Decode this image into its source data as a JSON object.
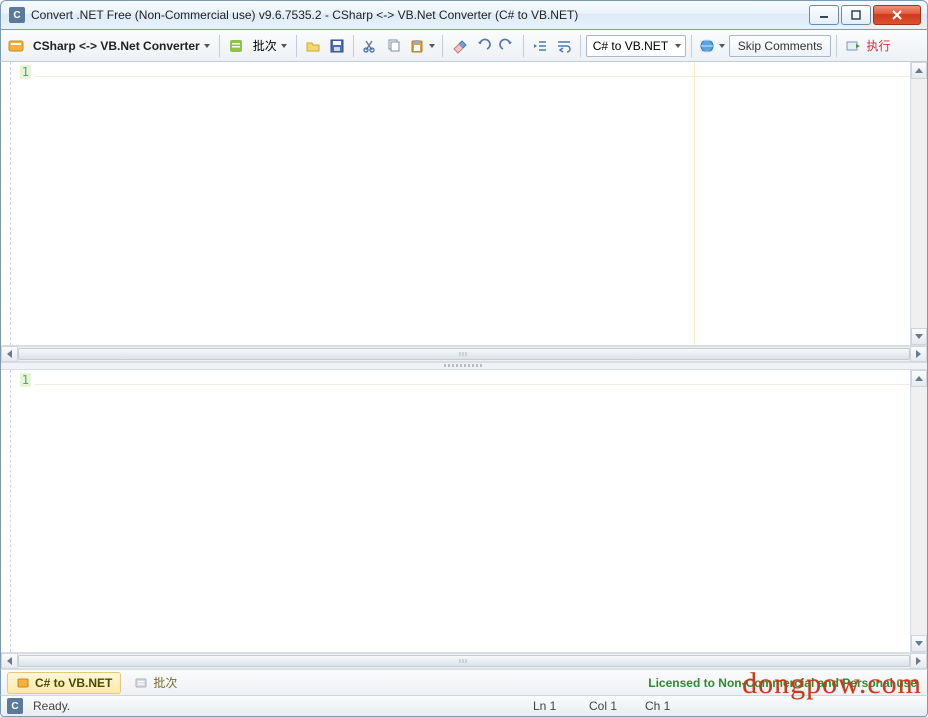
{
  "window": {
    "title": "Convert .NET Free (Non-Commercial use) v9.6.7535.2 - CSharp <-> VB.Net Converter (C# to VB.NET)",
    "app_icon_letter": "C"
  },
  "toolbar": {
    "mode_label": "CSharp <-> VB.Net Converter",
    "batch_label": "批次",
    "direction_combo": "C# to VB.NET",
    "skip_comments_label": "Skip Comments",
    "execute_label": "执行"
  },
  "editor_top": {
    "line1": "1"
  },
  "editor_bottom": {
    "line1": "1"
  },
  "tabs": {
    "active": "C# to VB.NET",
    "inactive": "批次"
  },
  "license_text": "Licensed to Non-Commercial and Personal use",
  "status": {
    "ready": "Ready.",
    "ln": "Ln 1",
    "col": "Col 1",
    "ch": "Ch 1",
    "icon_letter": "C"
  },
  "watermark": "dongpow.com"
}
